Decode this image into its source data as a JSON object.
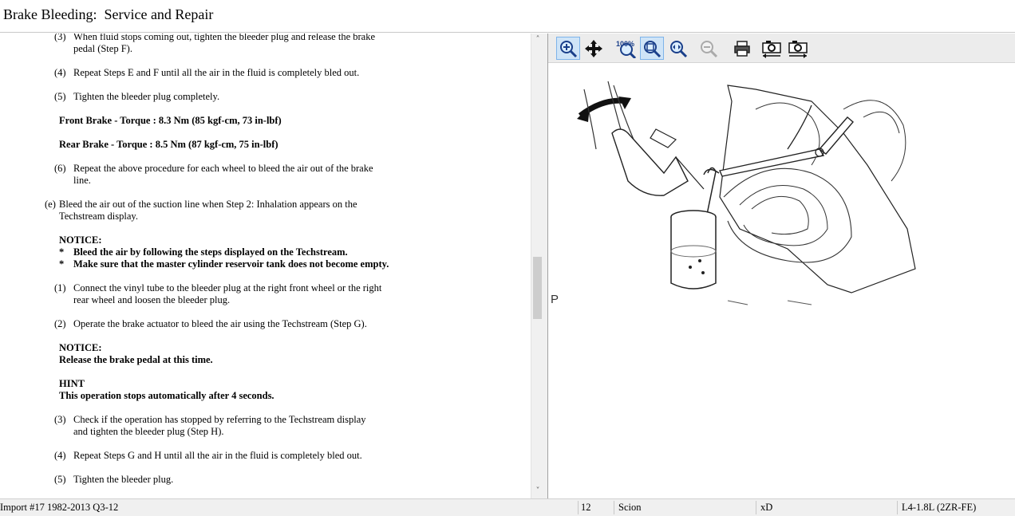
{
  "window": {
    "title": "Brake Bleeding:  Service and Repair"
  },
  "content": {
    "s3a_num": "(3)",
    "s3a_l1": "When fluid stops coming out, tighten the bleeder plug and release the brake",
    "s3a_l2": "pedal (Step F).",
    "s4a_num": "(4)",
    "s4a_l1": "Repeat Steps E and F until all the air in the fluid is completely bled out.",
    "s5a_num": "(5)",
    "s5a_l1": "Tighten the bleeder plug completely.",
    "torque_front": "Front Brake - Torque : 8.3 Nm (85 kgf-cm, 73 in-lbf)",
    "torque_rear": "Rear Brake - Torque : 8.5 Nm (87 kgf-cm, 75 in-lbf)",
    "s6_num": "(6)",
    "s6_l1": "Repeat the above procedure for each wheel to bleed the air out of the brake",
    "s6_l2": "line.",
    "e_num": "(e)",
    "e_l1": "Bleed the air out of the suction line when Step 2: Inhalation appears on the",
    "e_l2": "Techstream display.",
    "notice1_head": "NOTICE:",
    "notice1_b1": "Bleed the air by following the steps displayed on the Techstream.",
    "notice1_b2": "Make sure that the master cylinder reservoir tank does not become empty.",
    "bullet": "*",
    "s1_num": "(1)",
    "s1_l1": "Connect the vinyl tube to the bleeder plug at the right front wheel or the right",
    "s1_l2": "rear wheel and loosen the bleeder plug.",
    "s2_num": "(2)",
    "s2_l1": "Operate the brake actuator to bleed the air using the Techstream (Step G).",
    "notice2_head": "NOTICE:",
    "notice2_text": "Release the brake pedal at this time.",
    "hint_head": "HINT",
    "hint_text": "This operation stops automatically after 4 seconds.",
    "s3b_num": "(3)",
    "s3b_l1": "Check if the operation has stopped by referring to the Techstream display",
    "s3b_l2": "and tighten the bleeder plug (Step H).",
    "s4b_num": "(4)",
    "s4b_l1": "Repeat Steps G and H until all the air in the fluid is completely bled out.",
    "s5b_num": "(5)",
    "s5b_l1": "Tighten the bleeder plug."
  },
  "toolbar": {
    "zoom_100_label": "100%"
  },
  "diagram": {
    "corner_label": "P"
  },
  "statusbar": {
    "source": "Import #17 1982-2013 Q3-12",
    "year": "12",
    "make": "Scion",
    "model": "xD",
    "engine": "L4-1.8L (2ZR-FE)"
  },
  "icons": [
    "zoom-in-icon",
    "pan-icon",
    "zoom-100-icon",
    "zoom-fit-icon",
    "zoom-width-icon",
    "zoom-out-icon",
    "print-icon",
    "copy-image-icon",
    "save-image-icon",
    "scroll-up-icon",
    "scroll-down-icon"
  ]
}
